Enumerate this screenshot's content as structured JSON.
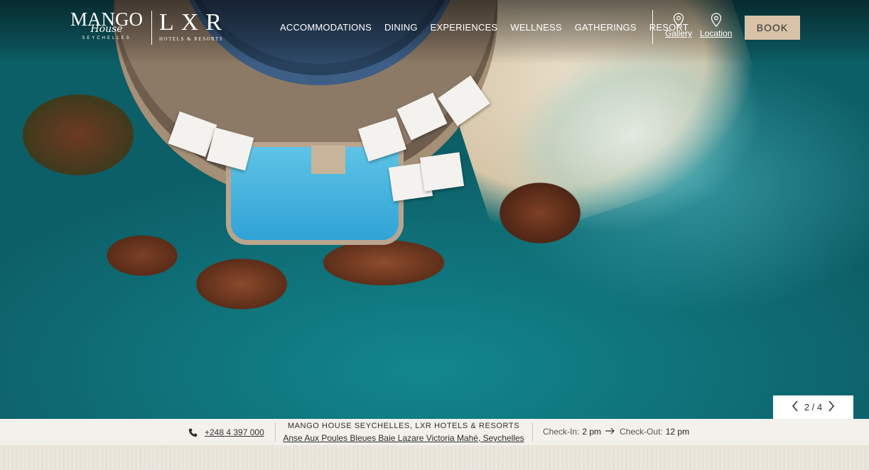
{
  "header": {
    "logo_mango_line1": "MANGO",
    "logo_mango_line2": "House",
    "logo_mango_line3": "SEYCHELLES",
    "logo_lxr_line1": "LXR",
    "logo_lxr_line2": "HOTELS & RESORTS",
    "nav": [
      "ACCOMMODATIONS",
      "DINING",
      "EXPERIENCES",
      "WELLNESS",
      "GATHERINGS",
      "RESORT"
    ],
    "gallery_label": "Gallery",
    "location_label": "Location",
    "book_label": "BOOK"
  },
  "slider": {
    "counter": "2 / 4",
    "prev_icon": "chevron-left-icon",
    "next_icon": "chevron-right-icon"
  },
  "infobar": {
    "phone": "+248 4 397 000",
    "hotel_name": "MANGO HOUSE SEYCHELLES, LXR HOTELS & RESORTS",
    "address": "Anse Aux Poules Bleues Baie Lazare Victoria Mahé, Seychelles",
    "checkin_label": "Check-In:",
    "checkin_time": "2 pm",
    "checkout_label": "Check-Out:",
    "checkout_time": "12 pm"
  },
  "colors": {
    "book_bg": "#d8c3a8",
    "infobar_bg": "#f3f1ec",
    "ocean": "#12868d"
  }
}
